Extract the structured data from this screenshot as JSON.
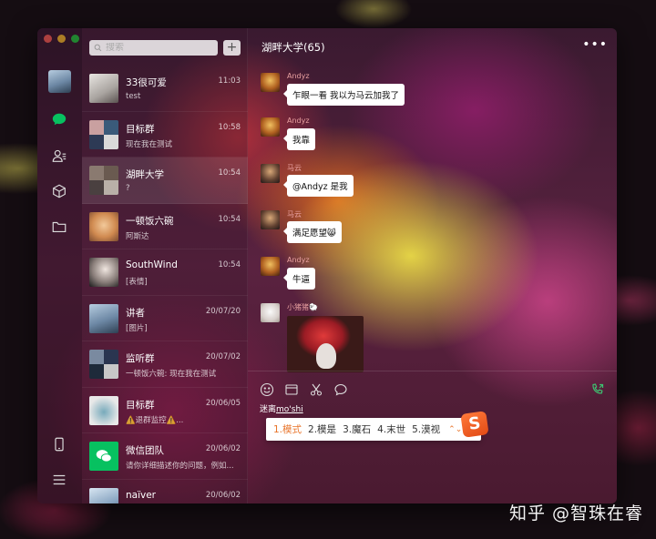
{
  "window": {
    "chat_title": "湖畔大学(65)",
    "more_icon": "more-icon"
  },
  "search": {
    "placeholder": "搜索"
  },
  "chats": [
    {
      "name": "33很可爱",
      "time": "11:03",
      "preview": "test"
    },
    {
      "name": "目标群",
      "time": "10:58",
      "preview": "现在我在测试"
    },
    {
      "name": "湖畔大学",
      "time": "10:54",
      "preview": "?"
    },
    {
      "name": "一顿饭六碗",
      "time": "10:54",
      "preview": "阿斯达"
    },
    {
      "name": "SouthWind",
      "time": "10:54",
      "preview": "[表情]"
    },
    {
      "name": "讲者",
      "time": "20/07/20",
      "preview": "[图片]"
    },
    {
      "name": "监听群",
      "time": "20/07/02",
      "preview": "一顿饭六碗: 现在我在测试"
    },
    {
      "name": "目标群",
      "time": "20/06/05",
      "preview": "⚠️退群监控⚠️..."
    },
    {
      "name": "微信团队",
      "time": "20/06/02",
      "preview": "请你详细描述你的问题，例如..."
    },
    {
      "name": "naïver",
      "time": "20/06/02",
      "preview": ""
    }
  ],
  "messages": [
    {
      "sender": "Andyz",
      "text": "乍眼一看 我以为马云加我了"
    },
    {
      "sender": "Andyz",
      "text": "我靠"
    },
    {
      "sender": "马云",
      "text": "@Andyz 是我"
    },
    {
      "sender": "马云",
      "text": "满足愿望😸"
    },
    {
      "sender": "Andyz",
      "text": "牛逼"
    },
    {
      "sender": "小猪猪🐑",
      "text": ""
    }
  ],
  "composer": {
    "typed_prefix": "迷离",
    "typed_pinyin": "mo'shi",
    "candidates": [
      "1.模式",
      "2.模是",
      "3.魔石",
      "4.末世",
      "5.漠视"
    ],
    "ime_logo": "S"
  },
  "watermark": "知乎 @智珠在睿",
  "colors": {
    "accent_green": "#07c160",
    "bubble": "#ffffff",
    "sender_name": "#e8a0a0",
    "ime_highlight": "#e8742a"
  }
}
